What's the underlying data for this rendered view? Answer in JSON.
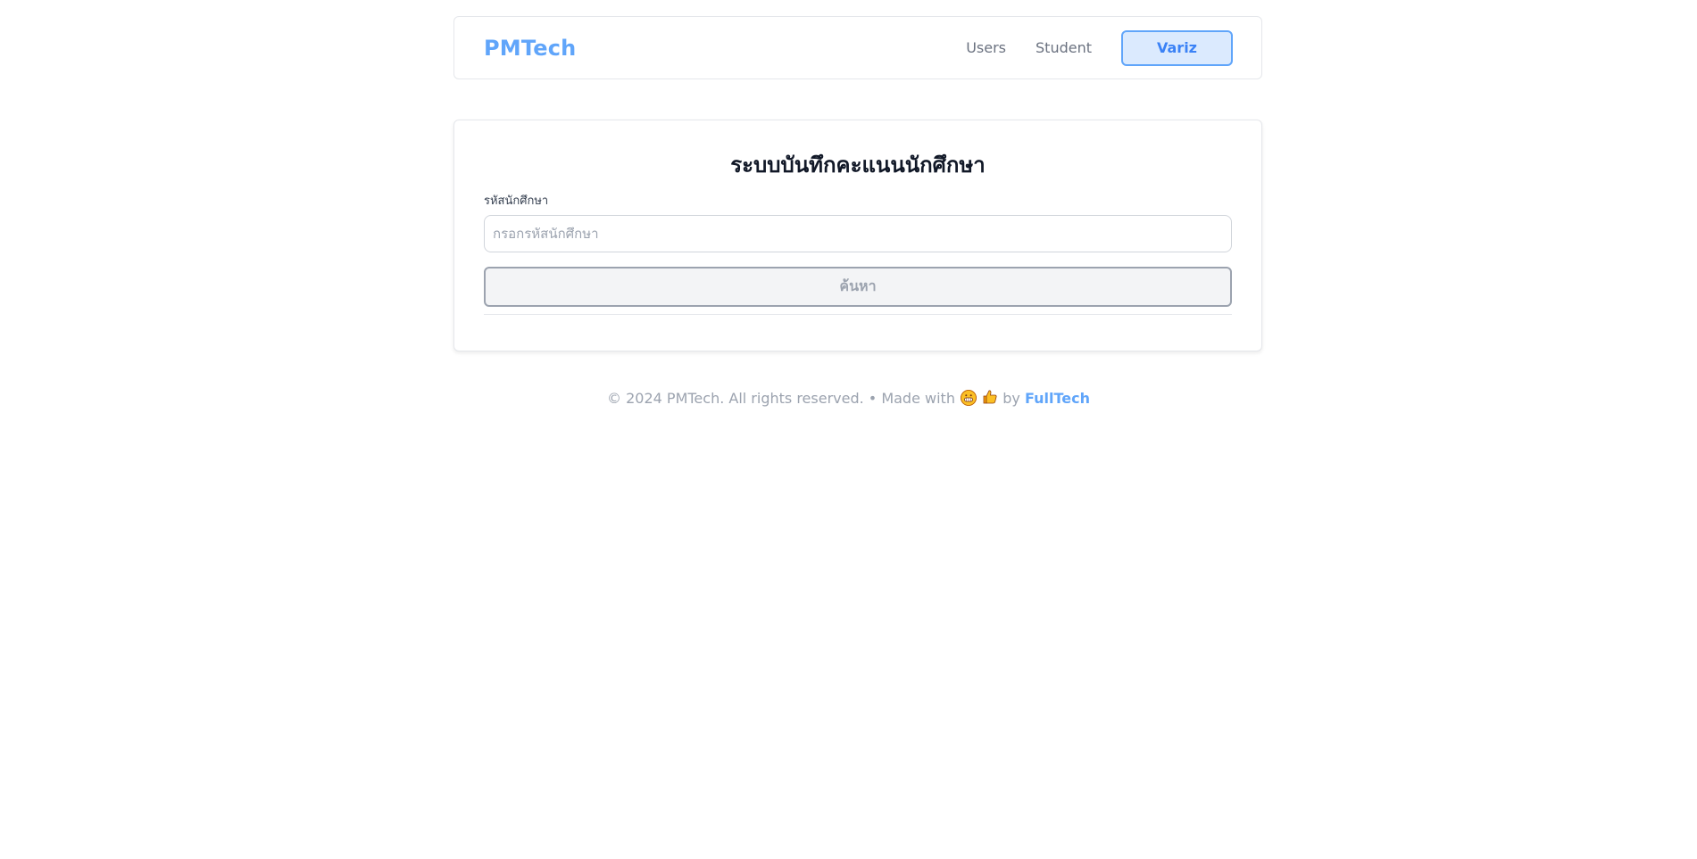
{
  "navbar": {
    "brand": "PMTech",
    "links": [
      "Users",
      "Student"
    ],
    "active_button": "Variz"
  },
  "card": {
    "title": "ระบบบันทึกคะแนนนักศึกษา",
    "field_label": "รหัสนักศึกษา",
    "field_placeholder": "กรอกรหัสนักศึกษา",
    "field_value": "",
    "search_button": "ค้นหา"
  },
  "footer": {
    "prefix": "© 2024 PMTech. All rights reserved. • Made with",
    "by": "by",
    "brand_link": "FullTech",
    "icons": [
      "grinning-face-icon",
      "thumbs-up-icon"
    ]
  },
  "colors": {
    "accent": "#60a5fa",
    "accent_bg": "#dbeafe",
    "muted": "#9ca3af"
  }
}
